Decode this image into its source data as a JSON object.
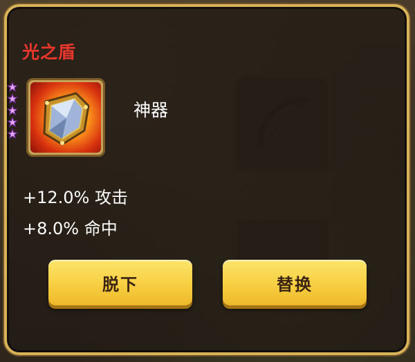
{
  "item": {
    "name": "光之盾",
    "quality": "神器",
    "star_count": 5,
    "stats": [
      "+12.0% 攻击",
      "+8.0% 命中"
    ]
  },
  "actions": {
    "unequip_label": "脱下",
    "replace_label": "替换"
  },
  "colors": {
    "title": "#e8372d",
    "button": "#f8d144",
    "panel_border": "#d9b35a"
  },
  "icons": {
    "item": "shield-icon",
    "star": "star-icon",
    "background_slot": "bow-icon"
  }
}
